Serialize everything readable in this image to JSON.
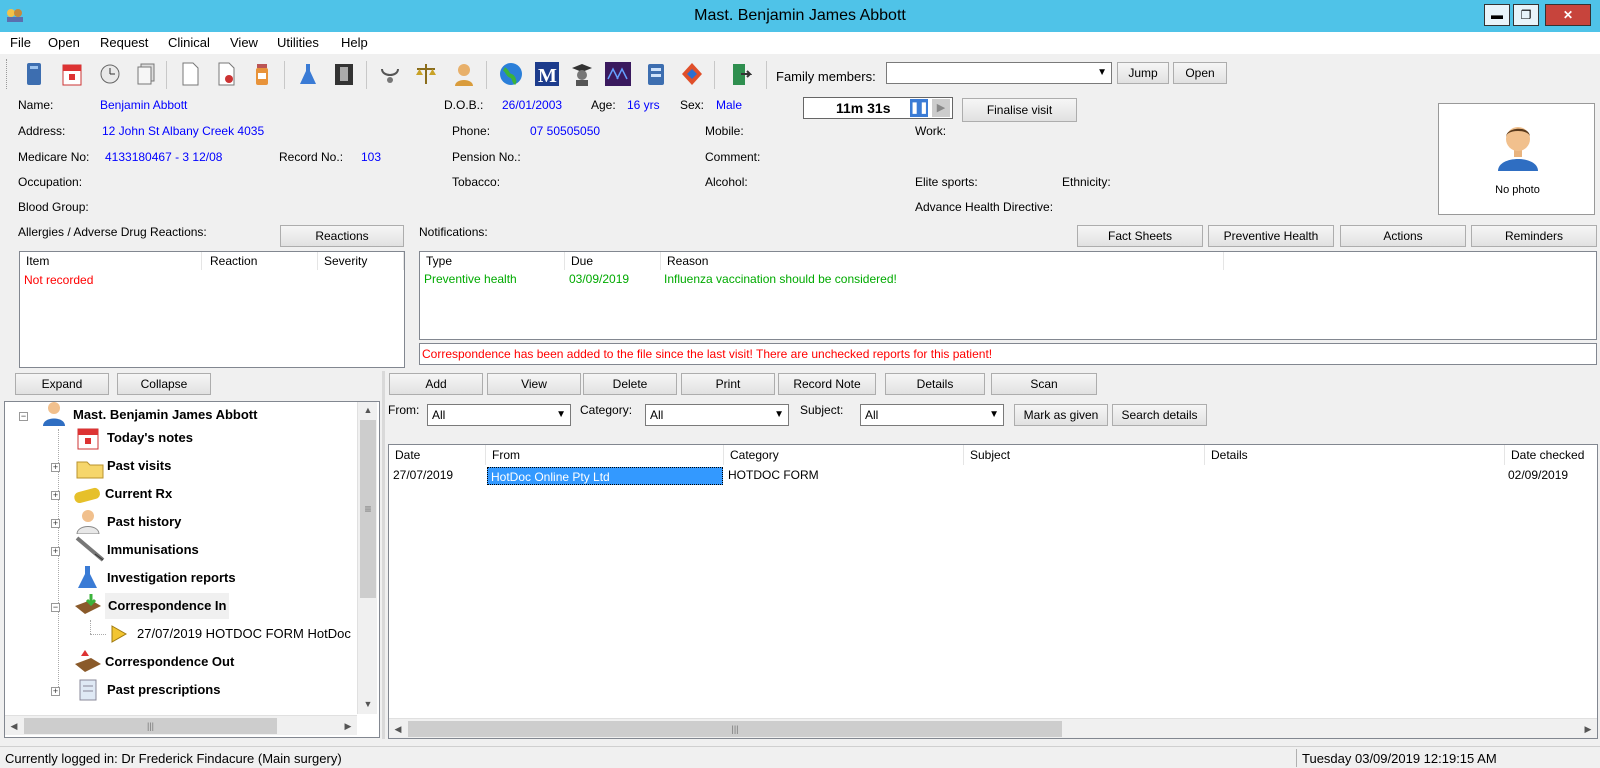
{
  "window": {
    "title": "Mast. Benjamin James Abbott"
  },
  "menu": [
    "File",
    "Open",
    "Request",
    "Clinical",
    "View",
    "Utilities",
    "Help"
  ],
  "toolbar": {
    "family_label": "Family members:",
    "family_value": "",
    "jump": "Jump",
    "open": "Open"
  },
  "patient": {
    "name_label": "Name:",
    "name": "Benjamin Abbott",
    "dob_label": "D.O.B.:",
    "dob": "26/01/2003",
    "age_label": "Age:",
    "age": "16 yrs",
    "sex_label": "Sex:",
    "sex": "Male",
    "address_label": "Address:",
    "address": "12 John St  Albany Creek  4035",
    "phone_label": "Phone:",
    "phone": "07 50505050",
    "mobile_label": "Mobile:",
    "work_label": "Work:",
    "medicare_label": "Medicare No:",
    "medicare": "4133180467 - 3  12/08",
    "record_label": "Record No.:",
    "record": "103",
    "pension_label": "Pension No.:",
    "comment_label": "Comment:",
    "occupation_label": "Occupation:",
    "tobacco_label": "Tobacco:",
    "alcohol_label": "Alcohol:",
    "elite_label": "Elite sports:",
    "ethnicity_label": "Ethnicity:",
    "blood_label": "Blood Group:",
    "ahd_label": "Advance Health Directive:",
    "photo_caption": "No photo"
  },
  "timer": {
    "value": "11m  31s",
    "finalise": "Finalise visit"
  },
  "allergies": {
    "label": "Allergies / Adverse Drug Reactions:",
    "reactions_button": "Reactions",
    "columns": [
      "Item",
      "Reaction",
      "Severity"
    ],
    "empty": "Not recorded"
  },
  "notifications": {
    "label": "Notifications:",
    "buttons": [
      "Fact Sheets",
      "Preventive Health",
      "Actions",
      "Reminders"
    ],
    "columns": [
      "Type",
      "Due",
      "Reason"
    ],
    "rows": [
      {
        "type": "Preventive health",
        "due": "03/09/2019",
        "reason": "Influenza vaccination should be considered!"
      }
    ],
    "alert": "Correspondence has been added to the file since the last visit!  There are unchecked reports for this patient!"
  },
  "tree": {
    "expand": "Expand",
    "collapse": "Collapse",
    "root": "Mast. Benjamin James Abbott",
    "items": [
      "Today's notes",
      "Past visits",
      "Current Rx",
      "Past history",
      "Immunisations",
      "Investigation reports",
      "Correspondence In",
      "Correspondence Out",
      "Past prescriptions"
    ],
    "child": "27/07/2019  HOTDOC FORM  HotDoc"
  },
  "corr": {
    "buttons": [
      "Add",
      "View",
      "Delete",
      "Print",
      "Record Note",
      "Details",
      "Scan"
    ],
    "from_label": "From:",
    "from_value": "All",
    "category_label": "Category:",
    "category_value": "All",
    "subject_label": "Subject:",
    "subject_value": "All",
    "mark": "Mark as given",
    "search": "Search details",
    "columns": [
      "Date",
      "From",
      "Category",
      "Subject",
      "Details",
      "Date checked"
    ],
    "rows": [
      {
        "date": "27/07/2019",
        "from": "HotDoc Online Pty Ltd",
        "category": "HOTDOC FORM",
        "subject": "",
        "details": "",
        "checked": "02/09/2019"
      }
    ]
  },
  "status": {
    "left": "Currently logged in:  Dr Frederick Findacure (Main surgery)",
    "right": "Tuesday 03/09/2019 12:19:15 AM"
  },
  "colors": {
    "titlebar": "#4fc3e8",
    "link_blue": "#0000ff",
    "alert_red": "#ff0000",
    "notify_green": "#00aa00",
    "selection": "#3399ff"
  }
}
